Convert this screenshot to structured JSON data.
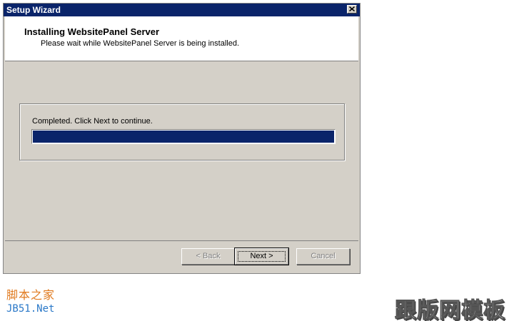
{
  "window": {
    "title": "Setup Wizard"
  },
  "header": {
    "title": "Installing WebsitePanel Server",
    "subtitle": "Please wait while WebsitePanel Server is being installed."
  },
  "progress": {
    "label": "Completed. Click Next to continue.",
    "value": 1.0,
    "fill_color": "#0a246a"
  },
  "buttons": {
    "back": "< Back",
    "next": "Next >",
    "cancel": "Cancel"
  },
  "watermark": {
    "left_line1": "脚本之家",
    "left_line2": "JB51.Net",
    "right": "跟版网模板"
  },
  "colors": {
    "titlebar": "#0a246a",
    "dialog_bg": "#d4d0c8"
  }
}
